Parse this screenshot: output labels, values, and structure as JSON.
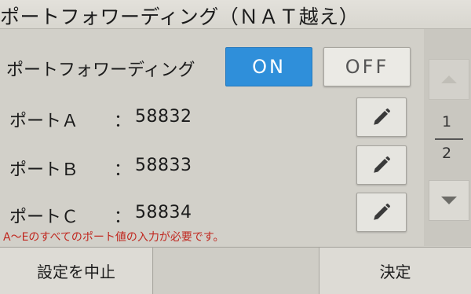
{
  "title": "ポートフォワーディング（ＮＡＴ越え）",
  "forwarding": {
    "label": "ポートフォワーディング",
    "on_label": "ON",
    "off_label": "OFF",
    "selected": "ON"
  },
  "ports": [
    {
      "label": "ポートＡ",
      "colon": "：",
      "value": "58832"
    },
    {
      "label": "ポートＢ",
      "colon": "：",
      "value": "58833"
    },
    {
      "label": "ポートＣ",
      "colon": "：",
      "value": "58834"
    }
  ],
  "warning": "A～Eのすべてのポート値の入力が必要です。",
  "pager": {
    "current": "1",
    "total": "2"
  },
  "footer": {
    "cancel_label": "設定を中止",
    "ok_label": "決定"
  },
  "icons": {
    "edit": "pencil-icon",
    "up": "up-arrow-icon",
    "down": "down-arrow-icon"
  },
  "colors": {
    "on_accent": "#2f8fda",
    "warning": "#c0271f"
  }
}
